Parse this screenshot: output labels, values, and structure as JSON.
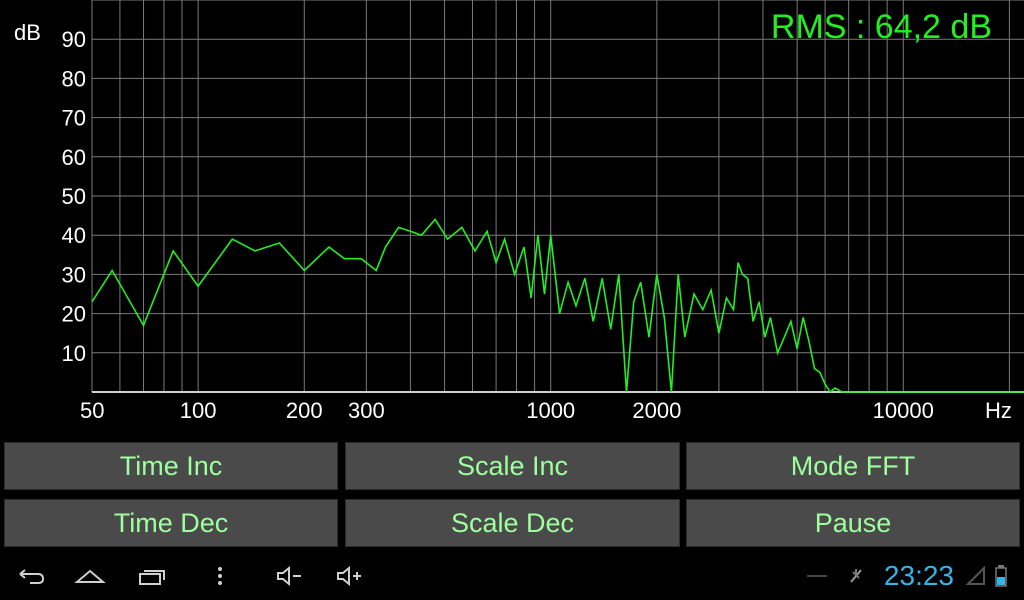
{
  "rms_readout": "RMS : 64,2 dB",
  "y_axis_unit": "dB",
  "x_axis_unit": "Hz",
  "buttons": {
    "time_inc": "Time Inc",
    "scale_inc": "Scale Inc",
    "mode_fft": "Mode FFT",
    "time_dec": "Time Dec",
    "scale_dec": "Scale Dec",
    "pause": "Pause"
  },
  "status": {
    "clock": "23:23"
  },
  "nav_icons": [
    "back-icon",
    "home-icon",
    "recent-apps-icon",
    "menu-icon",
    "volume-down-icon",
    "volume-up-icon"
  ],
  "status_icons": [
    "wifi-off-icon",
    "no-signal-icon",
    "battery-icon"
  ],
  "colors": {
    "trace": "#22ee22",
    "rms": "#22ee22",
    "button_text": "#9dff9d",
    "clock": "#33b5e5"
  },
  "chart_data": {
    "type": "line",
    "x_scale": "log",
    "xlim": [
      50,
      22000
    ],
    "ylim": [
      0,
      100
    ],
    "x_tick_labels": [
      "50",
      "100",
      "200",
      "300",
      "1000",
      "2000",
      "10000"
    ],
    "x_tick_values": [
      50,
      100,
      200,
      300,
      1000,
      2000,
      10000
    ],
    "y_tick_values": [
      10,
      20,
      30,
      40,
      50,
      60,
      70,
      80,
      90
    ],
    "grid": true,
    "series": [
      {
        "x": [
          50,
          57,
          70,
          85,
          100,
          125,
          145,
          170,
          200,
          235,
          260,
          290,
          320,
          340,
          370,
          400,
          430,
          470,
          510,
          560,
          610,
          660,
          700,
          740,
          790,
          840,
          880,
          920,
          960,
          1000,
          1060,
          1120,
          1180,
          1250,
          1320,
          1400,
          1480,
          1560,
          1640,
          1720,
          1800,
          1900,
          2000,
          2100,
          2200,
          2300,
          2400,
          2550,
          2700,
          2850,
          3000,
          3150,
          3300,
          3400,
          3500,
          3620,
          3750,
          3900,
          4050,
          4200,
          4400,
          4600,
          4800,
          5000,
          5200,
          5400,
          5600,
          5800,
          6000,
          6200,
          6400,
          6700,
          7000,
          7400,
          7800,
          8200,
          8600,
          9000,
          9500,
          10000,
          11000,
          13000,
          16000,
          20000,
          22000
        ],
        "y": [
          23,
          31,
          17,
          36,
          27,
          39,
          36,
          38,
          31,
          37,
          34,
          34,
          31,
          37,
          42,
          41,
          40,
          44,
          39,
          42,
          36,
          41,
          33,
          39,
          30,
          37,
          24,
          40,
          25,
          40,
          20,
          28,
          22,
          29,
          18,
          29,
          16,
          30,
          0,
          23,
          28,
          14,
          30,
          19,
          0,
          30,
          14,
          25,
          21,
          26,
          15,
          24,
          21,
          33,
          30,
          29,
          18,
          23,
          14,
          19,
          10,
          14,
          18,
          11,
          19,
          13,
          6,
          5,
          2,
          0,
          1,
          0,
          0,
          0,
          0,
          0,
          0,
          0,
          0,
          0,
          0,
          0,
          0,
          0,
          0
        ]
      }
    ]
  }
}
